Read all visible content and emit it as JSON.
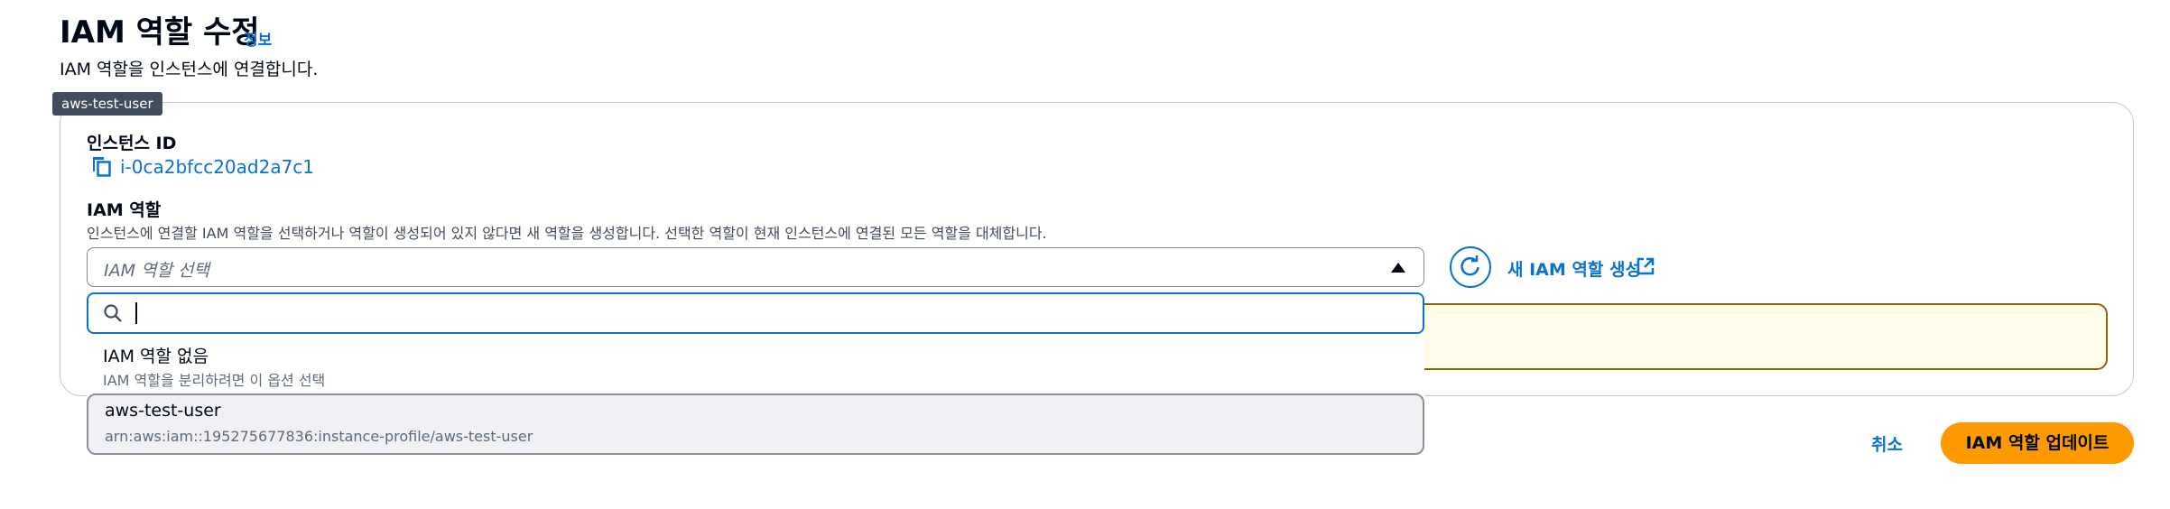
{
  "header": {
    "title": "IAM 역할 수정",
    "info_link": "정보",
    "description": "IAM 역할을 인스턴스에 연결합니다."
  },
  "tooltip": "aws-test-user",
  "instance": {
    "label": "인스턴스 ID",
    "value": "i-0ca2bfcc20ad2a7c1",
    "icon": "copy-icon"
  },
  "role": {
    "label": "IAM 역할",
    "description": "인스턴스에 연결할 IAM 역할을 선택하거나 역할이 생성되어 있지 않다면 새 역할을 생성합니다. 선택한 역할이 현재 인스턴스에 연결된 모든 역할을 대체합니다.",
    "select_placeholder": "IAM 역할 선택",
    "search_value": "",
    "options": [
      {
        "title": "IAM 역할 없음",
        "subtitle": "IAM 역할을 분리하려면 이 옵션 선택"
      },
      {
        "title": "aws-test-user",
        "subtitle": "arn:aws:iam::195275677836:instance-profile/aws-test-user"
      }
    ],
    "new_role_link": "새 IAM 역할 생성"
  },
  "footer": {
    "cancel": "취소",
    "update": "IAM 역할 업데이트"
  },
  "colors": {
    "link": "#0972d3",
    "primary_button": "#ff9900",
    "warning_bg": "#fffce9",
    "warning_border": "#8d6605"
  }
}
